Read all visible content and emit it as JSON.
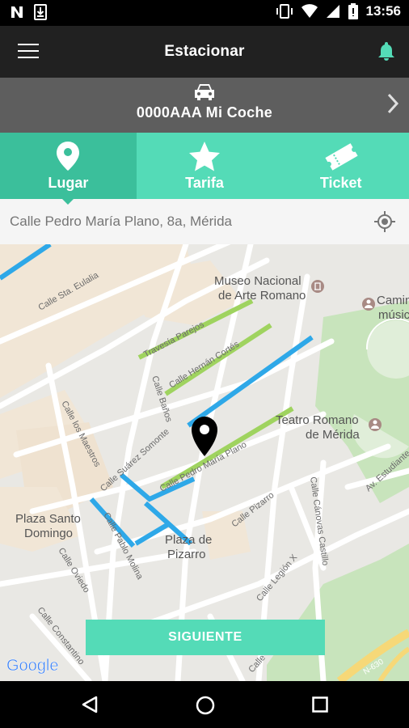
{
  "status_bar": {
    "time": "13:56",
    "icons": [
      "n-app-icon",
      "download-icon",
      "vibrate-icon",
      "wifi-icon",
      "cellular-icon",
      "battery-icon"
    ]
  },
  "app_bar": {
    "title": "Estacionar",
    "menu_icon": "menu-icon",
    "bell_icon": "bell-icon",
    "accent": "#54dbb7"
  },
  "vehicle": {
    "label": "0000AAA Mi Coche",
    "icon": "car-icon"
  },
  "tabs": [
    {
      "label": "Lugar",
      "icon": "location-pin-icon",
      "active": true
    },
    {
      "label": "Tarifa",
      "icon": "star-icon",
      "active": false
    },
    {
      "label": "Ticket",
      "icon": "ticket-icon",
      "active": false
    }
  ],
  "address": {
    "value": "Calle Pedro María Plano, 8a, Mérida",
    "locate_icon": "gps-locate-icon"
  },
  "map": {
    "pois": [
      {
        "name1": "Museo Nacional",
        "name2": "de Arte Romano"
      },
      {
        "name1": "Teatro Romano",
        "name2": "de Mérida"
      },
      {
        "name1": "Camin",
        "name2": "músic"
      },
      {
        "name1": "Plaza Santo",
        "name2": "Domingo"
      },
      {
        "name1": "Plaza de",
        "name2": "Pizarro"
      }
    ],
    "streets": [
      "Calle Sta. Eulalia",
      "Travesía Parejos",
      "Calle Hernán Cortés",
      "Calle Baños",
      "Calle los Maestros",
      "Calle Suárez Somonte",
      "Calle Pedro María Plano",
      "Calle Pizarro",
      "Calle Cánovas Castillo",
      "Calle Legión X",
      "Calle Pablo Molina",
      "Calle Oviedo",
      "Calle Constantino",
      "Calle Vía Ecu",
      "Av. Estudiante",
      "N-630"
    ],
    "attribution": "Google"
  },
  "cta_label": "SIGUIENTE",
  "nav_bar": {
    "icons": [
      "back-icon",
      "home-icon",
      "recents-icon"
    ]
  }
}
